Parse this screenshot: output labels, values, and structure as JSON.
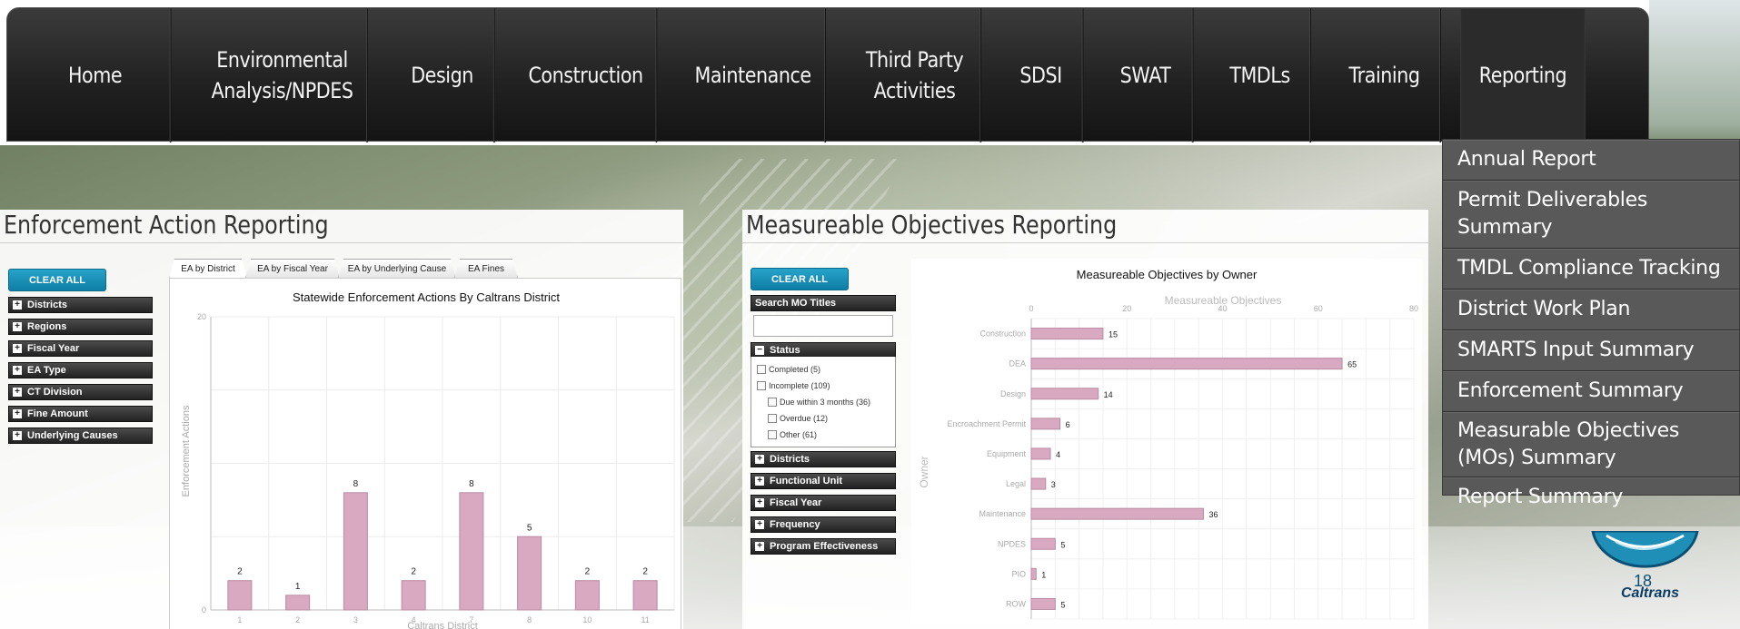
{
  "nav": {
    "items": [
      {
        "label_lines": [
          "Home"
        ]
      },
      {
        "label_lines": [
          "Environmental",
          "Analysis/NPDES"
        ]
      },
      {
        "label_lines": [
          "Design"
        ]
      },
      {
        "label_lines": [
          "Construction"
        ]
      },
      {
        "label_lines": [
          "Maintenance"
        ]
      },
      {
        "label_lines": [
          "Third Party",
          "Activities"
        ]
      },
      {
        "label_lines": [
          "SDSI"
        ]
      },
      {
        "label_lines": [
          "SWAT"
        ]
      },
      {
        "label_lines": [
          "TMDLs"
        ]
      },
      {
        "label_lines": [
          "Training"
        ]
      },
      {
        "label_lines": [
          "Reporting"
        ]
      }
    ],
    "dropdown": [
      "Annual Report",
      "Permit Deliverables Summary",
      "TMDL Compliance Tracking",
      "District Work Plan",
      "SMARTS Input Summary",
      "Enforcement Summary",
      "Measurable Objectives (MOs) Summary",
      "Report Summary"
    ]
  },
  "left_panel": {
    "title": "Enforcement Action Reporting",
    "clear_all": "CLEAR ALL",
    "facets": [
      "Districts",
      "Regions",
      "Fiscal Year",
      "EA Type",
      "CT Division",
      "Fine Amount",
      "Underlying Causes"
    ],
    "tabs": [
      "EA by District",
      "EA by Fiscal Year",
      "EA by Underlying Cause",
      "EA Fines"
    ]
  },
  "right_panel": {
    "title": "Measureable Objectives Reporting",
    "clear_all": "CLEAR ALL",
    "search_label": "Search MO Titles",
    "status_label": "Status",
    "status_options": [
      "Completed (5)",
      "Incomplete (109)",
      "Due within 3 months (36)",
      "Overdue (12)",
      "Other (61)"
    ],
    "facets": [
      "Districts",
      "Functional Unit",
      "Fiscal Year",
      "Frequency",
      "Program Effectiveness"
    ]
  },
  "logo": {
    "text": "Caltrans",
    "digit": "18"
  },
  "chart_data": [
    {
      "type": "bar",
      "title": "Statewide Enforcement Actions By Caltrans District",
      "xlabel": "Caltrans District",
      "ylabel": "Enforcement Actions",
      "categories": [
        "1",
        "2",
        "3",
        "4",
        "7",
        "8",
        "10",
        "11"
      ],
      "values": [
        2,
        1,
        8,
        2,
        8,
        5,
        2,
        2
      ],
      "ylim": [
        0,
        20
      ],
      "yticks": [
        0,
        20
      ],
      "grid": true,
      "color": "#d9a9c1"
    },
    {
      "type": "bar",
      "orientation": "horizontal",
      "title": "Measureable Objectives by Owner",
      "xlabel": "Measureable Objectives",
      "ylabel": "Owner",
      "categories": [
        "Construction",
        "DEA",
        "Design",
        "Encroachment Permit",
        "Equipment",
        "Legal",
        "Maintenance",
        "NPDES",
        "PIO",
        "ROW"
      ],
      "values": [
        15,
        65,
        14,
        6,
        4,
        3,
        36,
        5,
        1,
        5
      ],
      "xlim": [
        0,
        80
      ],
      "xticks": [
        0,
        20,
        40,
        60,
        80
      ],
      "grid": true,
      "color": "#d9a9c1"
    }
  ]
}
